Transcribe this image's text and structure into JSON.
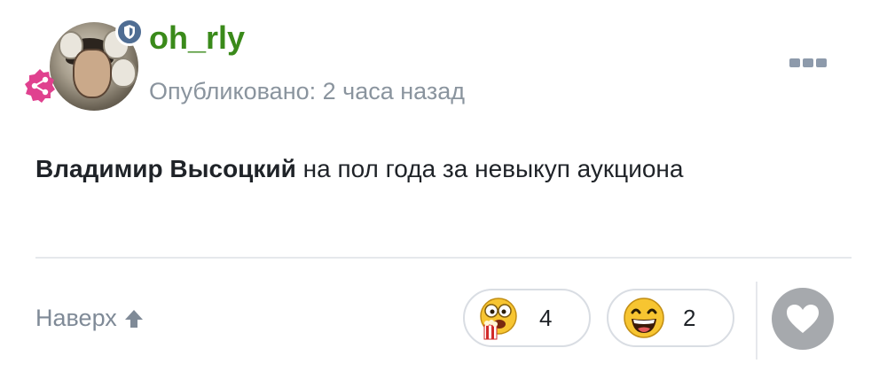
{
  "post": {
    "username": "oh_rly",
    "published": "Опубликовано: 2 часа назад",
    "text_bold": "Владимир Высоцкий",
    "text_rest": " на пол года за невыкуп аукциона",
    "go_top_label": "Наверх",
    "reactions": [
      {
        "icon": "popcorn-eyes-emoji-icon",
        "count": "4"
      },
      {
        "icon": "laughing-emoji-icon",
        "count": "2"
      }
    ],
    "icons": {
      "shield": "shield-badge-icon",
      "share": "share-badge-icon",
      "more": "more-dots-icon",
      "arrow": "arrow-up-icon",
      "heart": "heart-icon"
    },
    "colors": {
      "username": "#3a8a1a",
      "muted": "#8a949e",
      "shield": "#4f6d93",
      "share": "#e0418f",
      "like": "#a6a9ad"
    }
  }
}
